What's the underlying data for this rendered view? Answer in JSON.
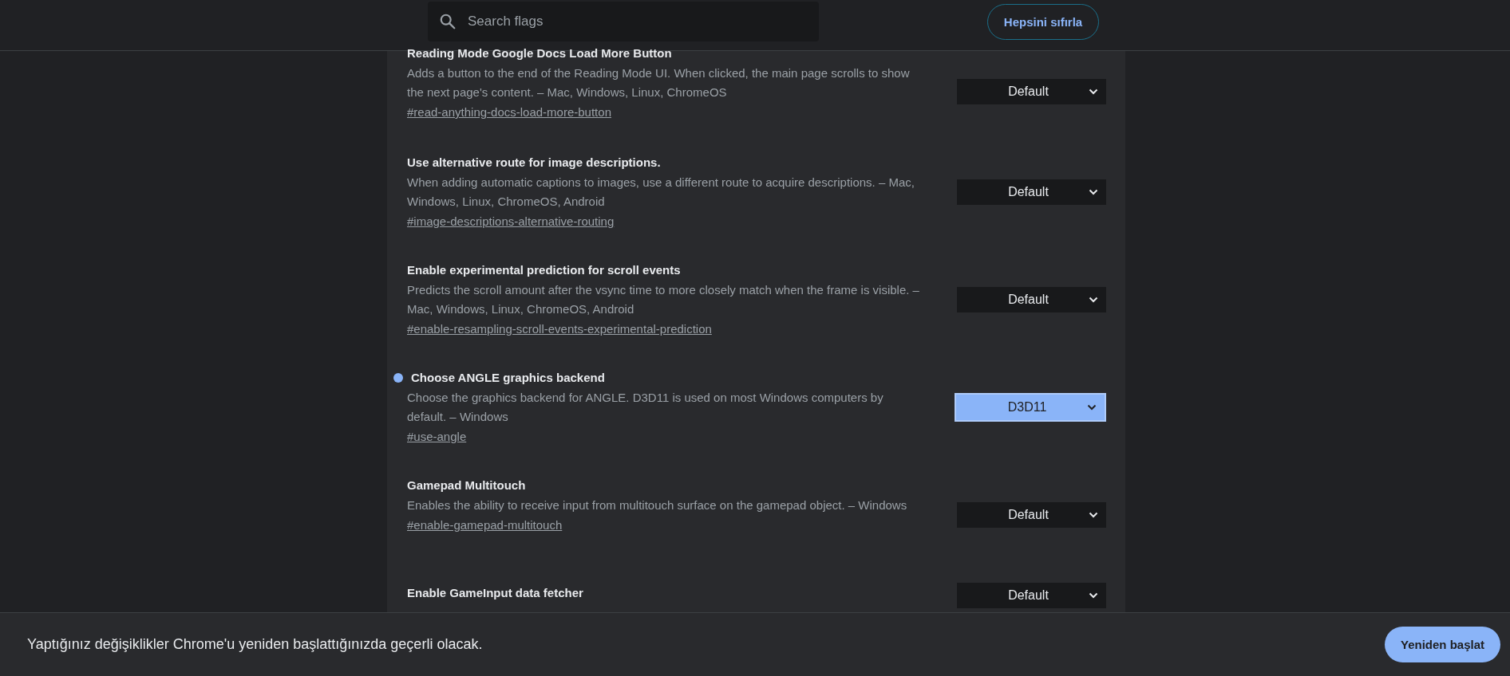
{
  "search": {
    "placeholder": "Search flags"
  },
  "reset_button": "Hepsini sıfırla",
  "flags": [
    {
      "title": "Reading Mode Google Docs Load More Button",
      "description": "Adds a button to the end of the Reading Mode UI. When clicked, the main page scrolls to show the next page's content. – Mac, Windows, Linux, ChromeOS",
      "link": "#read-anything-docs-load-more-button",
      "value": "Default",
      "modified": false
    },
    {
      "title": "Use alternative route for image descriptions.",
      "description": "When adding automatic captions to images, use a different route to acquire descriptions. – Mac, Windows, Linux, ChromeOS, Android",
      "link": "#image-descriptions-alternative-routing",
      "value": "Default",
      "modified": false
    },
    {
      "title": "Enable experimental prediction for scroll events",
      "description": "Predicts the scroll amount after the vsync time to more closely match when the frame is visible. – Mac, Windows, Linux, ChromeOS, Android",
      "link": "#enable-resampling-scroll-events-experimental-prediction",
      "value": "Default",
      "modified": false
    },
    {
      "title": "Choose ANGLE graphics backend",
      "description": "Choose the graphics backend for ANGLE. D3D11 is used on most Windows computers by default. – Windows",
      "link": "#use-angle",
      "value": "D3D11",
      "modified": true
    },
    {
      "title": "Gamepad Multitouch",
      "description": "Enables the ability to receive input from multitouch surface on the gamepad object. – Windows",
      "link": "#enable-gamepad-multitouch",
      "value": "Default",
      "modified": false
    },
    {
      "title": "Enable GameInput data fetcher",
      "value": "Default",
      "modified": false
    }
  ],
  "banner": {
    "message": "Yaptığınız değişiklikler Chrome'u yeniden başlattığınızda geçerli olacak.",
    "button": "Yeniden başlat"
  }
}
